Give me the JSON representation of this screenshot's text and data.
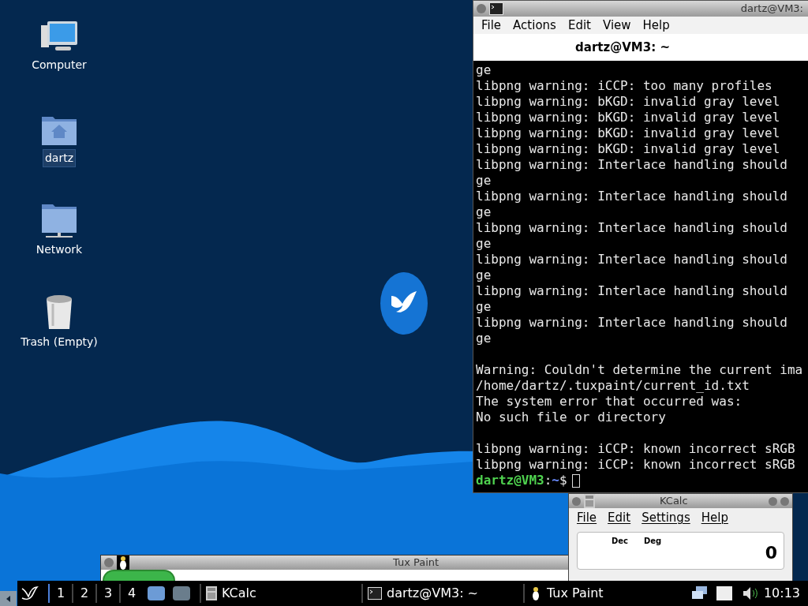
{
  "desktop_icons": [
    {
      "kind": "computer",
      "label": "Computer",
      "selected": false
    },
    {
      "kind": "home",
      "label": "dartz",
      "selected": true
    },
    {
      "kind": "network",
      "label": "Network",
      "selected": false
    },
    {
      "kind": "trash",
      "label": "Trash (Empty)",
      "selected": false
    }
  ],
  "terminal": {
    "window_title": "dartz@VM3:",
    "menu": [
      "File",
      "Actions",
      "Edit",
      "View",
      "Help"
    ],
    "tab_title": "dartz@VM3: ~",
    "blocks": [
      [
        "ge",
        "libpng warning: iCCP: too many profiles",
        "libpng warning: bKGD: invalid gray level",
        "libpng warning: bKGD: invalid gray level",
        "libpng warning: bKGD: invalid gray level",
        "libpng warning: bKGD: invalid gray level",
        "libpng warning: Interlace handling should",
        "ge",
        "libpng warning: Interlace handling should",
        "ge",
        "libpng warning: Interlace handling should",
        "ge",
        "libpng warning: Interlace handling should",
        "ge",
        "libpng warning: Interlace handling should",
        "ge",
        "libpng warning: Interlace handling should",
        "ge"
      ],
      [
        "Warning: Couldn't determine the current ima",
        "/home/dartz/.tuxpaint/current_id.txt",
        "The system error that occurred was:",
        "No such file or directory"
      ],
      [
        "libpng warning: iCCP: known incorrect sRGB",
        "libpng warning: iCCP: known incorrect sRGB"
      ]
    ],
    "prompt": {
      "user_host": "dartz@VM3",
      "separator": ":",
      "path": "~",
      "symbol": "$"
    }
  },
  "kcalc": {
    "window_title": "KCalc",
    "menu": [
      "File",
      "Edit",
      "Settings",
      "Help"
    ],
    "base": "Dec",
    "angle": "Deg",
    "display": "0"
  },
  "tuxpaint": {
    "window_title": "Tux Paint"
  },
  "taskbar": {
    "desktops": [
      {
        "label": "1",
        "selected": true
      },
      {
        "label": "2",
        "selected": false
      },
      {
        "label": "3",
        "selected": false
      },
      {
        "label": "4",
        "selected": false
      }
    ],
    "tasks": [
      {
        "kind": "calc",
        "label": "KCalc"
      },
      {
        "kind": "terminal",
        "label": "dartz@VM3: ~"
      },
      {
        "kind": "paint",
        "label": "Tux Paint"
      }
    ],
    "clock": "10:13"
  }
}
